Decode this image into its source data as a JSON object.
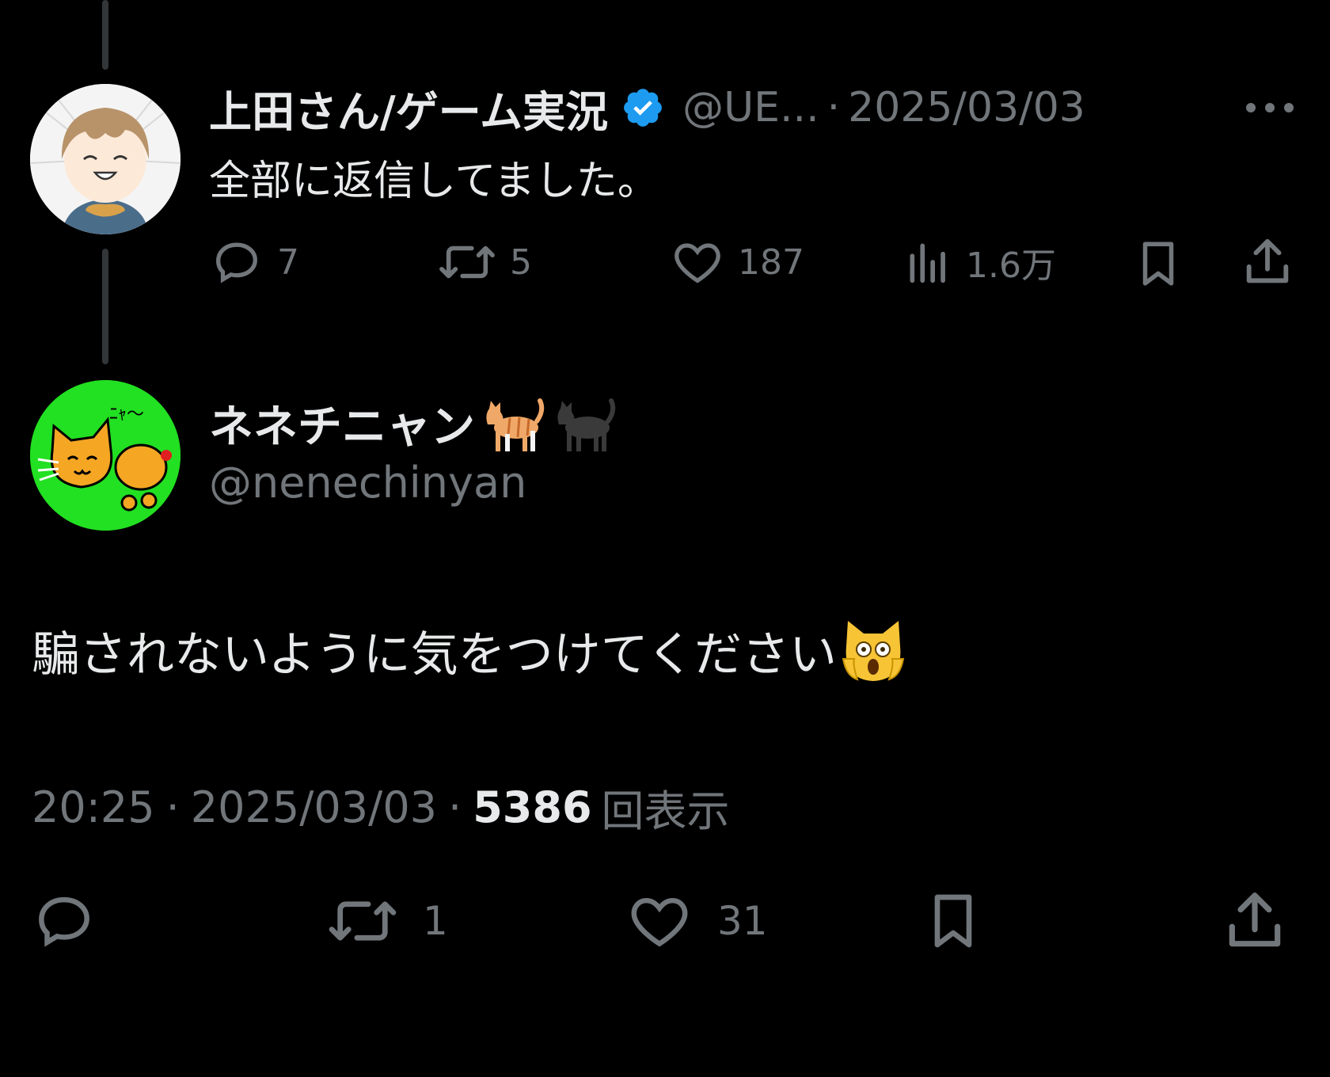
{
  "parent_tweet": {
    "display_name": "上田さん/ゲーム実況",
    "handle": "@UE...",
    "separator": "·",
    "date": "2025/03/03",
    "text": "全部に返信してました。",
    "replies": "7",
    "retweets": "5",
    "likes": "187",
    "views": "1.6万"
  },
  "main_tweet": {
    "display_name": "ネネチニャン",
    "display_name_emojis": [
      "orange-cat",
      "black-cat"
    ],
    "handle": "@nenechinyan",
    "text": "騙されないように気をつけてください",
    "text_emoji": "weary-cat-face",
    "time": "20:25",
    "separator": "·",
    "date": "2025/03/03",
    "views_count": "5386",
    "views_label": "回表示",
    "retweets": "1",
    "likes": "31"
  },
  "colors": {
    "background": "#000000",
    "primary_text": "#e7e9ea",
    "secondary_text": "#71767b",
    "verified_blue": "#1d9bf0",
    "avatar2_bg": "#22e022",
    "thread_line": "#333639"
  }
}
